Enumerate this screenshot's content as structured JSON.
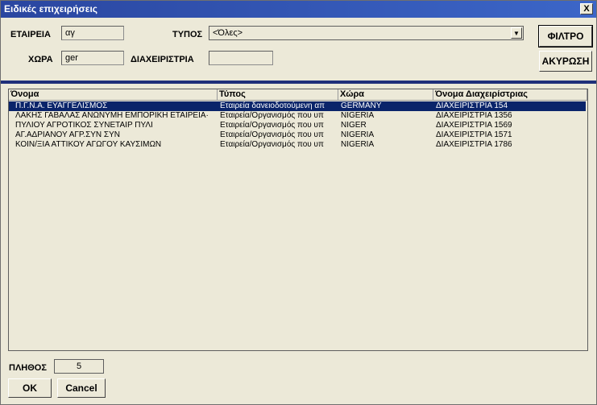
{
  "window": {
    "title": "Ειδικές επιχειρήσεις",
    "close_glyph": "X"
  },
  "filters": {
    "company_label": "ΕΤΑΙΡΕΙΑ",
    "company_value": "αγ",
    "type_label": "ΤΥΠΟΣ",
    "type_value": "<Όλες>",
    "country_label": "ΧΩΡΑ",
    "country_value": "ger",
    "manager_label": "ΔΙΑΧΕΙΡΙΣΤΡΙΑ",
    "manager_value": ""
  },
  "buttons": {
    "filter": "ΦΙΛΤΡΟ",
    "cancel_filter": "ΑΚΥΡΩΣΗ",
    "ok": "OK",
    "cancel": "Cancel"
  },
  "grid": {
    "columns": [
      "Όνομα",
      "Τύπος",
      "Χώρα",
      "Όνομα Διαχειρίστριας"
    ],
    "rows": [
      {
        "name": "Π.Γ.Ν.Α. ΕΥΑΓΓΕΛΙΣΜΟΣ",
        "type": "Εταιρεία δανειοδοτούμενη απ",
        "country": "GERMANY",
        "manager": "ΔΙΑΧΕΙΡΙΣΤΡΙΑ 154",
        "selected": true
      },
      {
        "name": "ΛΑΚΗΣ ΓΑΒΑΛΑΣ ΑΝΩΝΥΜΗ ΕΜΠΟΡΙΚΗ ΕΤΑΙΡΕΙΑ·",
        "type": "Εταιρεία/Οργανισμός που υπ",
        "country": "NIGERIA",
        "manager": "ΔΙΑΧΕΙΡΙΣΤΡΙΑ 1356",
        "selected": false
      },
      {
        "name": "ΠΥΛΙΟΥ ΑΓΡΟΤΙΚΟΣ ΣΥΝΕΤΑΙΡ ΠΥΛΙ",
        "type": "Εταιρεία/Οργανισμός που υπ",
        "country": "NIGER",
        "manager": "ΔΙΑΧΕΙΡΙΣΤΡΙΑ 1569",
        "selected": false
      },
      {
        "name": "ΑΓ.ΑΔΡΙΑΝΟΥ ΑΓΡ.ΣΥΝ       ΣΥΝ",
        "type": "Εταιρεία/Οργανισμός που υπ",
        "country": "NIGERIA",
        "manager": "ΔΙΑΧΕΙΡΙΣΤΡΙΑ 1571",
        "selected": false
      },
      {
        "name": "ΚΟΙΝ/ΞΙΑ  ΑΤΤΙΚΟΥ ΑΓΩΓΟΥ  ΚΑΥΣΙΜΩΝ",
        "type": "Εταιρεία/Οργανισμός που υπ",
        "country": "NIGERIA",
        "manager": "ΔΙΑΧΕΙΡΙΣΤΡΙΑ 1786",
        "selected": false
      }
    ]
  },
  "footer": {
    "count_label": "ΠΛΗΘΟΣ",
    "count_value": "5"
  },
  "icons": {
    "combo_arrow": "dropdown-arrow-icon"
  },
  "colors": {
    "title_bar": "#2a46a0",
    "selection": "#0a246a",
    "divider": "#1f2f7a",
    "background": "#ece9d8"
  }
}
